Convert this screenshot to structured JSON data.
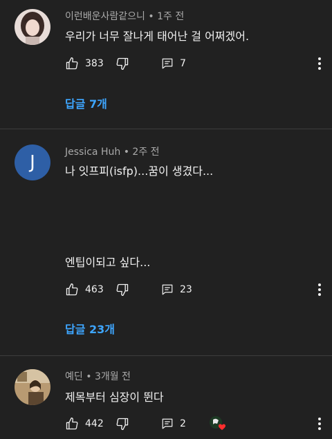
{
  "comments": [
    {
      "author": "이런배운사람같으니",
      "time": "1주 전",
      "text_lines": [
        "우리가 너무 잘나게 태어난 걸 어쩌겠어."
      ],
      "likes": "383",
      "replies_count": "7",
      "replies_label": "답글 7개",
      "avatar_icon": "photo-avatar"
    },
    {
      "author": "Jessica Huh",
      "time": "2주 전",
      "avatar_letter": "J",
      "avatar_color": "#2e5fa6",
      "text_lines": [
        "나 잇프피(isfp)...꿈이 생겼다...",
        "엔팁이되고 싶다..."
      ],
      "likes": "463",
      "replies_count": "23",
      "replies_label": "답글 23개"
    },
    {
      "author": "예딘",
      "time": "3개월 전",
      "text_lines": [
        "제목부터 심장이 뛴다"
      ],
      "likes": "442",
      "replies_count": "2",
      "avatar_icon": "photo-avatar",
      "creator_heart_icon": "creator-heart-icon"
    }
  ],
  "accent_color": "#3ea6ff",
  "separator": "•"
}
